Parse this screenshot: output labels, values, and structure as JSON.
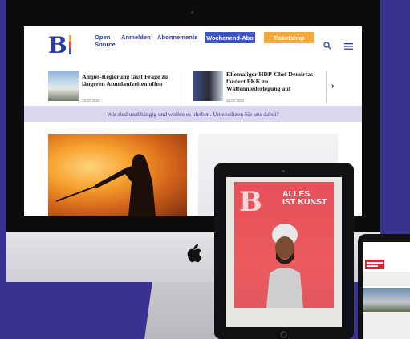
{
  "site": {
    "nav": {
      "open_source": "Open\nSource",
      "login": "Anmelden",
      "abo": "Abonnements",
      "weekend_abo": "Wochenend-Abo",
      "ticketshop": "Ticketshop"
    },
    "teasers": [
      {
        "title": "Ampel-Regierung lässt Frage zu längeren Atomlaufzeiten offen",
        "date": "18.07.2022"
      },
      {
        "title": "Ehemaliger HDP-Chef Demirtas fordert PKK zu Waffenniederlegung auf",
        "date": "18.07.2022"
      }
    ],
    "support_banner": "Wir sind unabhängig und wollen es bleiben. Unterstützen Sie uns dabei?",
    "icons": [
      "search-icon",
      "menu-icon",
      "chevron-right-icon",
      "apple-logo"
    ]
  },
  "magazine": {
    "headline_1": "ALLES",
    "headline_2": "IST KUNST"
  },
  "colors": {
    "background": "#3a3291",
    "nav_blue": "#2a3aa6",
    "weekend_button": "#3f55c4",
    "ticket_button": "#f2a93b",
    "banner": "#dcd7f0",
    "magazine_red": "#e84f59"
  }
}
